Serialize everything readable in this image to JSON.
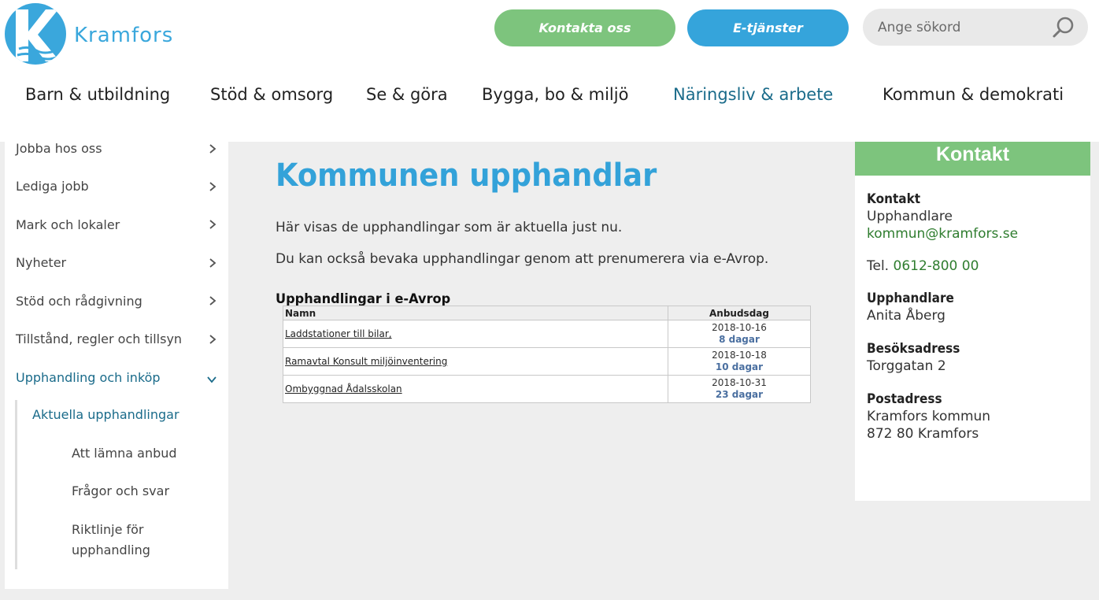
{
  "header": {
    "logo_name": "Kramfors",
    "contact_button": "Kontakta oss",
    "eservices_button": "E-tjänster",
    "search_placeholder": "Ange sökord"
  },
  "mainnav": {
    "items": [
      {
        "label": "Barn & utbildning"
      },
      {
        "label": "Stöd & omsorg"
      },
      {
        "label": "Se & göra"
      },
      {
        "label": "Bygga, bo & miljö"
      },
      {
        "label": "Näringsliv & arbete",
        "active": true
      },
      {
        "label": "Kommun & demokrati"
      }
    ]
  },
  "sidebar": {
    "items": [
      {
        "label": "Jobba hos oss"
      },
      {
        "label": "Lediga jobb"
      },
      {
        "label": "Mark och lokaler"
      },
      {
        "label": "Nyheter"
      },
      {
        "label": "Stöd och rådgivning"
      },
      {
        "label": "Tillstånd, regler och tillsyn"
      },
      {
        "label": "Upphandling och inköp",
        "expanded": true
      }
    ],
    "current": "Aktuella upphandlingar",
    "subitems": [
      {
        "label": "Att lämna anbud"
      },
      {
        "label": "Frågor och svar"
      },
      {
        "label": "Riktlinje för upphandling"
      }
    ]
  },
  "main": {
    "title": "Kommunen upphandlar",
    "paragraph1": "Här visas de upphandlingar som är aktuella just nu.",
    "paragraph2": "Du kan också bevaka upphandlingar genom att prenumerera via e-Avrop.",
    "section_title": "Upphandlingar i e-Avrop",
    "table": {
      "col_name": "Namn",
      "col_date": "Anbudsdag",
      "rows": [
        {
          "name": "Laddstationer till bilar,",
          "date": "2018-10-16",
          "days": "8 dagar"
        },
        {
          "name": "Ramavtal Konsult miljöinventering",
          "date": "2018-10-18",
          "days": "10 dagar"
        },
        {
          "name": "Ombyggnad Ådalsskolan",
          "date": "2018-10-31",
          "days": "23 dagar"
        }
      ]
    }
  },
  "contact": {
    "heading": "Kontakt",
    "contact_label": "Kontakt",
    "contact_role": "Upphandlare",
    "email": "kommun@kramfors.se",
    "phone_prefix": "Tel.",
    "phone": "0612-800 00",
    "buyer_label": "Upphandlare",
    "buyer_name": "Anita Åberg",
    "visit_label": "Besöksadress",
    "visit_address": "Torggatan 2",
    "postal_label": "Postadress",
    "postal_line1": "Kramfors kommun",
    "postal_line2": "872 80 Kramfors"
  },
  "colors": {
    "brand_blue": "#33a2d9",
    "green": "#7dc47d",
    "nav_active": "#1a6b8a"
  }
}
